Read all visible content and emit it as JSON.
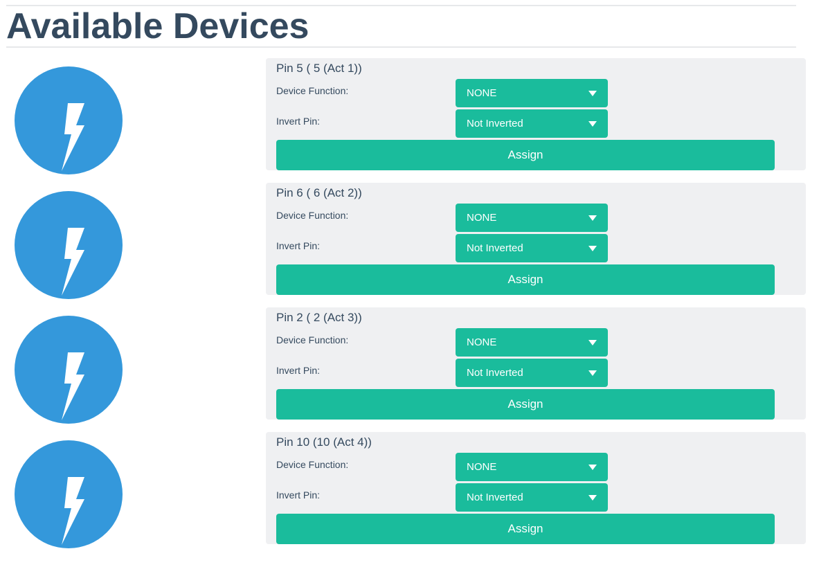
{
  "page": {
    "title": "Available Devices"
  },
  "colors": {
    "accent": "#1abc9c",
    "avatar": "#3498db",
    "text": "#34495e",
    "card_bg": "#eff0f2"
  },
  "device_icon": "lightning-bolt-icon",
  "devices": [
    {
      "title": "Pin 5 ( 5 (Act 1))",
      "function_label": "Device Function:",
      "function_value": "NONE",
      "invert_label": "Invert Pin:",
      "invert_value": "Not Inverted",
      "assign_label": "Assign"
    },
    {
      "title": "Pin 6 ( 6 (Act 2))",
      "function_label": "Device Function:",
      "function_value": "NONE",
      "invert_label": "Invert Pin:",
      "invert_value": "Not Inverted",
      "assign_label": "Assign"
    },
    {
      "title": "Pin 2 ( 2 (Act 3))",
      "function_label": "Device Function:",
      "function_value": "NONE",
      "invert_label": "Invert Pin:",
      "invert_value": "Not Inverted",
      "assign_label": "Assign"
    },
    {
      "title": "Pin 10 (10 (Act 4))",
      "function_label": "Device Function:",
      "function_value": "NONE",
      "invert_label": "Invert Pin:",
      "invert_value": "Not Inverted",
      "assign_label": "Assign"
    }
  ]
}
